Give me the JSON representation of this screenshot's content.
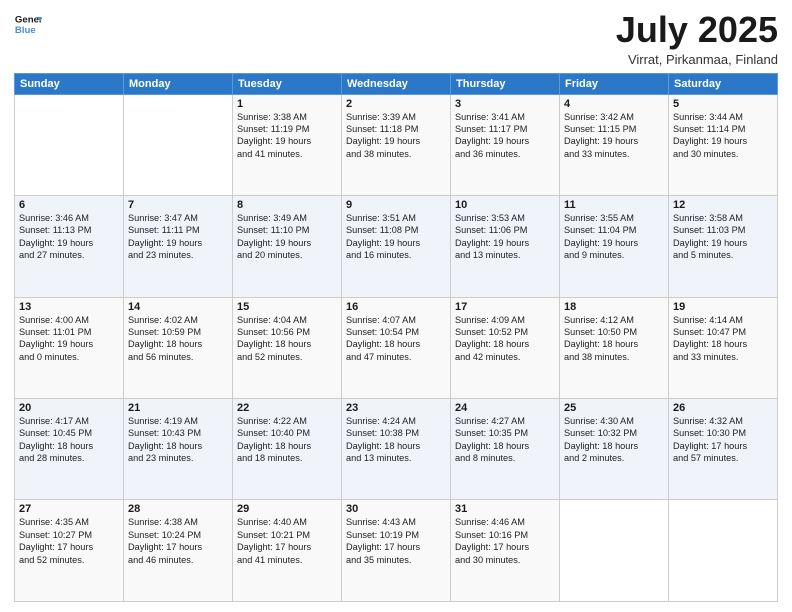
{
  "header": {
    "logo_line1": "General",
    "logo_line2": "Blue",
    "month_title": "July 2025",
    "location": "Virrat, Pirkanmaa, Finland"
  },
  "weekdays": [
    "Sunday",
    "Monday",
    "Tuesday",
    "Wednesday",
    "Thursday",
    "Friday",
    "Saturday"
  ],
  "weeks": [
    [
      {
        "day": "",
        "text": ""
      },
      {
        "day": "",
        "text": ""
      },
      {
        "day": "1",
        "text": "Sunrise: 3:38 AM\nSunset: 11:19 PM\nDaylight: 19 hours\nand 41 minutes."
      },
      {
        "day": "2",
        "text": "Sunrise: 3:39 AM\nSunset: 11:18 PM\nDaylight: 19 hours\nand 38 minutes."
      },
      {
        "day": "3",
        "text": "Sunrise: 3:41 AM\nSunset: 11:17 PM\nDaylight: 19 hours\nand 36 minutes."
      },
      {
        "day": "4",
        "text": "Sunrise: 3:42 AM\nSunset: 11:15 PM\nDaylight: 19 hours\nand 33 minutes."
      },
      {
        "day": "5",
        "text": "Sunrise: 3:44 AM\nSunset: 11:14 PM\nDaylight: 19 hours\nand 30 minutes."
      }
    ],
    [
      {
        "day": "6",
        "text": "Sunrise: 3:46 AM\nSunset: 11:13 PM\nDaylight: 19 hours\nand 27 minutes."
      },
      {
        "day": "7",
        "text": "Sunrise: 3:47 AM\nSunset: 11:11 PM\nDaylight: 19 hours\nand 23 minutes."
      },
      {
        "day": "8",
        "text": "Sunrise: 3:49 AM\nSunset: 11:10 PM\nDaylight: 19 hours\nand 20 minutes."
      },
      {
        "day": "9",
        "text": "Sunrise: 3:51 AM\nSunset: 11:08 PM\nDaylight: 19 hours\nand 16 minutes."
      },
      {
        "day": "10",
        "text": "Sunrise: 3:53 AM\nSunset: 11:06 PM\nDaylight: 19 hours\nand 13 minutes."
      },
      {
        "day": "11",
        "text": "Sunrise: 3:55 AM\nSunset: 11:04 PM\nDaylight: 19 hours\nand 9 minutes."
      },
      {
        "day": "12",
        "text": "Sunrise: 3:58 AM\nSunset: 11:03 PM\nDaylight: 19 hours\nand 5 minutes."
      }
    ],
    [
      {
        "day": "13",
        "text": "Sunrise: 4:00 AM\nSunset: 11:01 PM\nDaylight: 19 hours\nand 0 minutes."
      },
      {
        "day": "14",
        "text": "Sunrise: 4:02 AM\nSunset: 10:59 PM\nDaylight: 18 hours\nand 56 minutes."
      },
      {
        "day": "15",
        "text": "Sunrise: 4:04 AM\nSunset: 10:56 PM\nDaylight: 18 hours\nand 52 minutes."
      },
      {
        "day": "16",
        "text": "Sunrise: 4:07 AM\nSunset: 10:54 PM\nDaylight: 18 hours\nand 47 minutes."
      },
      {
        "day": "17",
        "text": "Sunrise: 4:09 AM\nSunset: 10:52 PM\nDaylight: 18 hours\nand 42 minutes."
      },
      {
        "day": "18",
        "text": "Sunrise: 4:12 AM\nSunset: 10:50 PM\nDaylight: 18 hours\nand 38 minutes."
      },
      {
        "day": "19",
        "text": "Sunrise: 4:14 AM\nSunset: 10:47 PM\nDaylight: 18 hours\nand 33 minutes."
      }
    ],
    [
      {
        "day": "20",
        "text": "Sunrise: 4:17 AM\nSunset: 10:45 PM\nDaylight: 18 hours\nand 28 minutes."
      },
      {
        "day": "21",
        "text": "Sunrise: 4:19 AM\nSunset: 10:43 PM\nDaylight: 18 hours\nand 23 minutes."
      },
      {
        "day": "22",
        "text": "Sunrise: 4:22 AM\nSunset: 10:40 PM\nDaylight: 18 hours\nand 18 minutes."
      },
      {
        "day": "23",
        "text": "Sunrise: 4:24 AM\nSunset: 10:38 PM\nDaylight: 18 hours\nand 13 minutes."
      },
      {
        "day": "24",
        "text": "Sunrise: 4:27 AM\nSunset: 10:35 PM\nDaylight: 18 hours\nand 8 minutes."
      },
      {
        "day": "25",
        "text": "Sunrise: 4:30 AM\nSunset: 10:32 PM\nDaylight: 18 hours\nand 2 minutes."
      },
      {
        "day": "26",
        "text": "Sunrise: 4:32 AM\nSunset: 10:30 PM\nDaylight: 17 hours\nand 57 minutes."
      }
    ],
    [
      {
        "day": "27",
        "text": "Sunrise: 4:35 AM\nSunset: 10:27 PM\nDaylight: 17 hours\nand 52 minutes."
      },
      {
        "day": "28",
        "text": "Sunrise: 4:38 AM\nSunset: 10:24 PM\nDaylight: 17 hours\nand 46 minutes."
      },
      {
        "day": "29",
        "text": "Sunrise: 4:40 AM\nSunset: 10:21 PM\nDaylight: 17 hours\nand 41 minutes."
      },
      {
        "day": "30",
        "text": "Sunrise: 4:43 AM\nSunset: 10:19 PM\nDaylight: 17 hours\nand 35 minutes."
      },
      {
        "day": "31",
        "text": "Sunrise: 4:46 AM\nSunset: 10:16 PM\nDaylight: 17 hours\nand 30 minutes."
      },
      {
        "day": "",
        "text": ""
      },
      {
        "day": "",
        "text": ""
      }
    ]
  ]
}
